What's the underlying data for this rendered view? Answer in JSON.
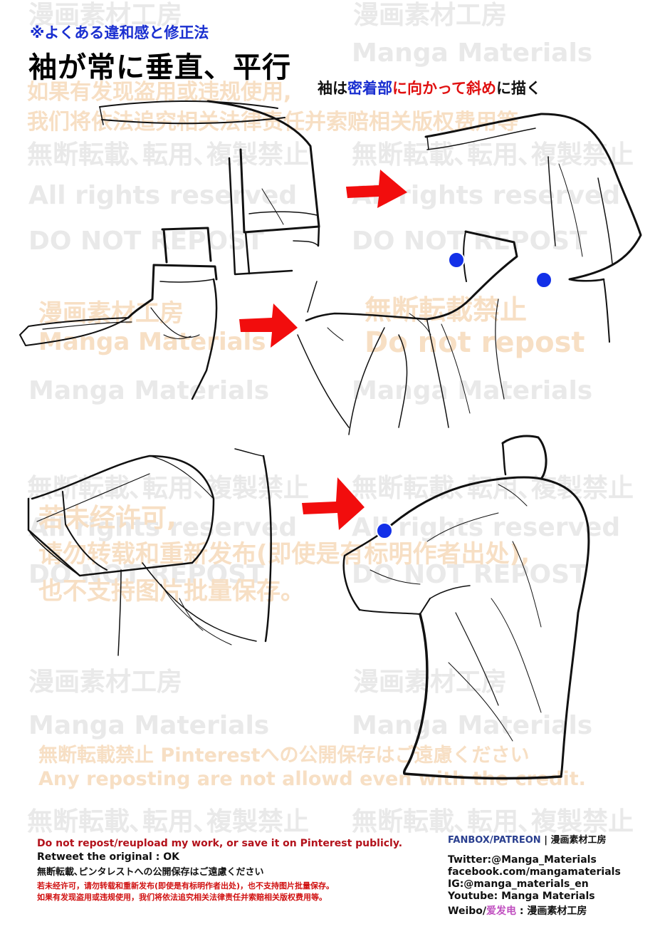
{
  "header": {
    "subtitle": "※よくある違和感と修正法",
    "title": "袖が常に垂直、平行",
    "note_part1": "袖は",
    "note_part2": "密着部",
    "note_part3": "に向かって斜め",
    "note_part4": "に描く"
  },
  "watermarks": {
    "cn_warning_line1": "如果有发现盗用或违规使用,",
    "cn_warning_line2": "我们将依法追究相关法律责任并索赔相关版权费用等",
    "jp_no_repost": "無断転載､転用､複製禁止",
    "all_rights": "All rights reserved",
    "do_not_repost_caps": "DO NOT REPOST",
    "studio_name": "漫画素材工房",
    "brand": "Manga Materials",
    "jp_short": "無断転載禁止",
    "do_not_repost": "Do not repost",
    "cn_permission_line1": "若未经许可,",
    "cn_permission_line2": "请勿转载和重新发布(即使是有标明作者出处),",
    "cn_permission_line3": "也不支持图片批量保存。",
    "jp_pinterest": "無断転載禁止 Pinterestへの公開保存はご遠慮ください",
    "en_credit": "Any reposting are not allowd even with the credit."
  },
  "colors": {
    "accent_blue": "#1a2fd0",
    "accent_red": "#e01010",
    "arrow_red": "#f20d0d",
    "dot_blue": "#1330e8",
    "watermark_orange": "#f7dfc4",
    "watermark_gray": "#e9e9e9",
    "footer_darkred": "#b3121b"
  },
  "footer": {
    "left": {
      "line1": "Do not repost/reupload my work, or save it on Pinterest publicly.",
      "line2": "Retweet the original : OK",
      "line3": "無断転載､ピンタレストへの公開保存はご遠慮ください",
      "line4": "若未经许可，请勿转载和重新发布(即使是有标明作者出处)，也不支持图片批量保存。",
      "line5": "如果有发现盗用或违规使用，我们将依法追究相关法律责任并索赔相关版权费用等。"
    },
    "right": {
      "fanbox": "FANBOX/PATREON",
      "separator": "|",
      "studio": "漫画素材工房",
      "twitter": "Twitter:@Manga_Materials",
      "facebook": "facebook.com/mangamaterials",
      "instagram": "IG:@manga_materials_en",
      "youtube": "Youtube: Manga Materials",
      "weibo_prefix": "Weibo/",
      "weibo_highlight": "爱发电",
      "weibo_suffix": ": 漫画素材工房"
    }
  }
}
